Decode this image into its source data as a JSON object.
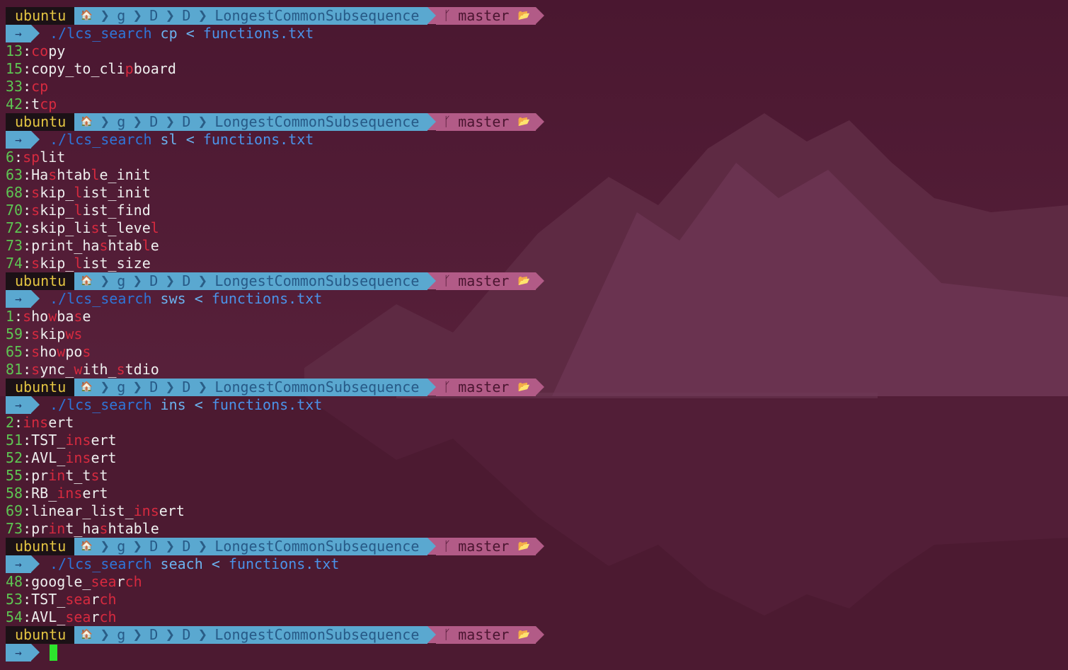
{
  "prompt": {
    "user": "ubuntu",
    "home_icon": "house-icon",
    "path": [
      "g",
      "D",
      "D",
      "LongestCommonSubsequence"
    ],
    "branch_icon": "git-branch-icon",
    "branch": "master",
    "folder_icon": "folder-icon",
    "arrow": "→"
  },
  "blocks": [
    {
      "program": "./lcs_search",
      "arg": "cp",
      "redirect": "<",
      "file": "functions.txt",
      "results": [
        {
          "line": "13",
          "segments": [
            [
              "co",
              true
            ],
            [
              "p",
              false
            ],
            [
              "y",
              false
            ]
          ]
        },
        {
          "line": "15",
          "segments": [
            [
              "co",
              false
            ],
            [
              "p",
              false
            ],
            [
              "y_to_",
              false
            ],
            [
              "c",
              false
            ],
            [
              "li",
              false
            ],
            [
              "p",
              true
            ],
            [
              "board",
              false
            ]
          ]
        },
        {
          "line": "33",
          "segments": [
            [
              "cp",
              true
            ]
          ]
        },
        {
          "line": "42",
          "segments": [
            [
              "t",
              false
            ],
            [
              "cp",
              true
            ]
          ]
        }
      ]
    },
    {
      "program": "./lcs_search",
      "arg": "sl",
      "redirect": "<",
      "file": "functions.txt",
      "results": [
        {
          "line": "6",
          "segments": [
            [
              "sp",
              true
            ],
            [
              "l",
              false
            ],
            [
              "it",
              false
            ]
          ]
        },
        {
          "line": "63",
          "segments": [
            [
              "Ha",
              false
            ],
            [
              "s",
              true
            ],
            [
              "htab",
              false
            ],
            [
              "l",
              true
            ],
            [
              "e_init",
              false
            ]
          ]
        },
        {
          "line": "68",
          "segments": [
            [
              "s",
              true
            ],
            [
              "kip_",
              false
            ],
            [
              "l",
              true
            ],
            [
              "ist_init",
              false
            ]
          ]
        },
        {
          "line": "70",
          "segments": [
            [
              "s",
              true
            ],
            [
              "kip_",
              false
            ],
            [
              "l",
              true
            ],
            [
              "ist_find",
              false
            ]
          ]
        },
        {
          "line": "72",
          "segments": [
            [
              "skip_li",
              false
            ],
            [
              "s",
              true
            ],
            [
              "t_leve",
              false
            ],
            [
              "l",
              true
            ]
          ]
        },
        {
          "line": "73",
          "segments": [
            [
              "print_ha",
              false
            ],
            [
              "s",
              true
            ],
            [
              "htab",
              false
            ],
            [
              "l",
              true
            ],
            [
              "e",
              false
            ]
          ]
        },
        {
          "line": "74",
          "segments": [
            [
              "s",
              true
            ],
            [
              "kip_",
              false
            ],
            [
              "l",
              true
            ],
            [
              "ist_size",
              false
            ]
          ]
        }
      ]
    },
    {
      "program": "./lcs_search",
      "arg": "sws",
      "redirect": "<",
      "file": "functions.txt",
      "results": [
        {
          "line": "1",
          "segments": [
            [
              "s",
              true
            ],
            [
              "ho",
              false
            ],
            [
              "w",
              true
            ],
            [
              "ba",
              false
            ],
            [
              "s",
              true
            ],
            [
              "e",
              false
            ]
          ]
        },
        {
          "line": "59",
          "segments": [
            [
              "s",
              true
            ],
            [
              "kip",
              false
            ],
            [
              "ws",
              true
            ]
          ]
        },
        {
          "line": "65",
          "segments": [
            [
              "s",
              true
            ],
            [
              "ho",
              false
            ],
            [
              "w",
              true
            ],
            [
              "po",
              false
            ],
            [
              "s",
              true
            ]
          ]
        },
        {
          "line": "81",
          "segments": [
            [
              "s",
              true
            ],
            [
              "ync_",
              false
            ],
            [
              "w",
              true
            ],
            [
              "ith_",
              false
            ],
            [
              "s",
              true
            ],
            [
              "tdio",
              false
            ]
          ]
        }
      ]
    },
    {
      "program": "./lcs_search",
      "arg": "ins",
      "redirect": "<",
      "file": "functions.txt",
      "results": [
        {
          "line": "2",
          "segments": [
            [
              "ins",
              true
            ],
            [
              "ert",
              false
            ]
          ]
        },
        {
          "line": "51",
          "segments": [
            [
              "TST_",
              false
            ],
            [
              "ins",
              true
            ],
            [
              "ert",
              false
            ]
          ]
        },
        {
          "line": "52",
          "segments": [
            [
              "AVL_",
              false
            ],
            [
              "ins",
              true
            ],
            [
              "ert",
              false
            ]
          ]
        },
        {
          "line": "55",
          "segments": [
            [
              "pr",
              false
            ],
            [
              "in",
              true
            ],
            [
              "t_t",
              false
            ],
            [
              "s",
              true
            ],
            [
              "t",
              false
            ]
          ]
        },
        {
          "line": "58",
          "segments": [
            [
              "RB_",
              false
            ],
            [
              "ins",
              true
            ],
            [
              "ert",
              false
            ]
          ]
        },
        {
          "line": "69",
          "segments": [
            [
              "linear_list_",
              false
            ],
            [
              "ins",
              true
            ],
            [
              "ert",
              false
            ]
          ]
        },
        {
          "line": "73",
          "segments": [
            [
              "pr",
              false
            ],
            [
              "in",
              true
            ],
            [
              "t_ha",
              false
            ],
            [
              "s",
              true
            ],
            [
              "htable",
              false
            ]
          ]
        }
      ]
    },
    {
      "program": "./lcs_search",
      "arg": "seach",
      "redirect": "<",
      "file": "functions.txt",
      "results": [
        {
          "line": "48",
          "segments": [
            [
              "google_",
              false
            ],
            [
              "sea",
              true
            ],
            [
              "r",
              false
            ],
            [
              "ch",
              true
            ]
          ]
        },
        {
          "line": "53",
          "segments": [
            [
              "TST_",
              false
            ],
            [
              "sea",
              true
            ],
            [
              "r",
              false
            ],
            [
              "ch",
              true
            ]
          ]
        },
        {
          "line": "54",
          "segments": [
            [
              "AVL_",
              false
            ],
            [
              "sea",
              true
            ],
            [
              "r",
              false
            ],
            [
              "ch",
              true
            ]
          ]
        }
      ]
    }
  ],
  "colors": {
    "background": "#47162d",
    "user_segment_bg": "#1b1116",
    "user_text": "#e4c542",
    "path_segment_bg": "#5aa8d0",
    "git_segment_bg": "#b25b87",
    "line_number": "#5ec653",
    "match_highlight": "#d62a3f",
    "cursor": "#2de52d"
  }
}
